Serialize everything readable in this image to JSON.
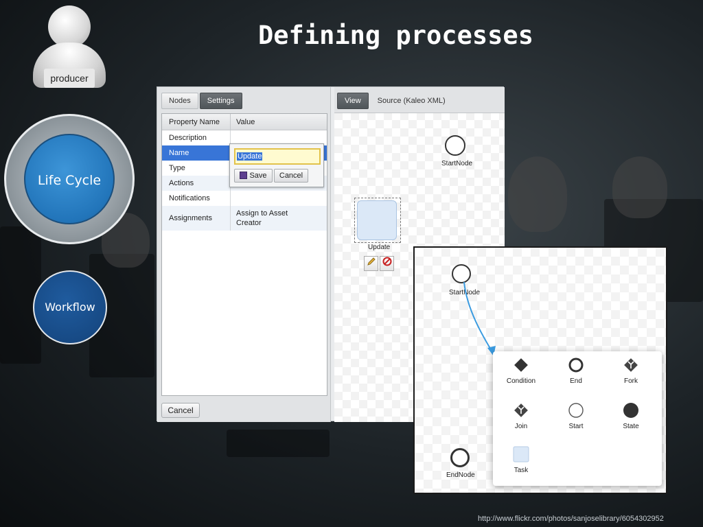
{
  "slide": {
    "title": "Defining processes",
    "credit": "http://www.flickr.com/photos/sanjoselibrary/6054302952"
  },
  "avatar": {
    "label": "producer"
  },
  "circles": {
    "lifecycle": "Life Cycle",
    "workflow": "Workflow"
  },
  "editor": {
    "left_tabs": [
      "Nodes",
      "Settings"
    ],
    "right_tabs": [
      "View",
      "Source (Kaleo XML)"
    ],
    "table": {
      "headers": [
        "Property Name",
        "Value"
      ],
      "rows": [
        {
          "name": "Description",
          "value": ""
        },
        {
          "name": "Name",
          "value": ""
        },
        {
          "name": "Type",
          "value": ""
        },
        {
          "name": "Actions",
          "value": ""
        },
        {
          "name": "Notifications",
          "value": ""
        },
        {
          "name": "Assignments",
          "value": "Assign to Asset Creator"
        }
      ]
    },
    "name_editor": {
      "value": "Update",
      "save": "Save",
      "cancel": "Cancel"
    },
    "cancel_button": "Cancel",
    "canvas": {
      "start_node": "StartNode",
      "task_node": "Update"
    }
  },
  "overlay": {
    "start_node": "StartNode",
    "end_node": "EndNode",
    "palette": [
      "Condition",
      "End",
      "Fork",
      "Join",
      "Start",
      "State",
      "Task"
    ]
  },
  "colors": {
    "accent_blue": "#2275ba",
    "workflow_blue": "#174a85",
    "selection": "#3875d7"
  }
}
